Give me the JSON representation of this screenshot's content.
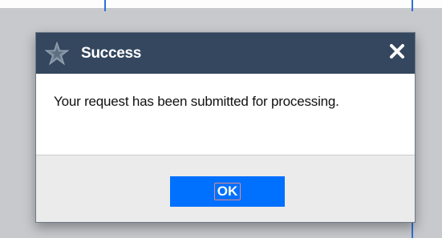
{
  "dialog": {
    "title": "Success",
    "header_icon": "star-icon",
    "close_icon": "close-icon",
    "message": "Your request has been submitted for processing.",
    "ok_label": "OK"
  },
  "colors": {
    "header_bg": "#34475f",
    "ok_button_bg": "#0070ff",
    "body_bg": "#ffffff",
    "footer_bg": "#ebebeb",
    "backdrop": "#c7c9cd"
  }
}
